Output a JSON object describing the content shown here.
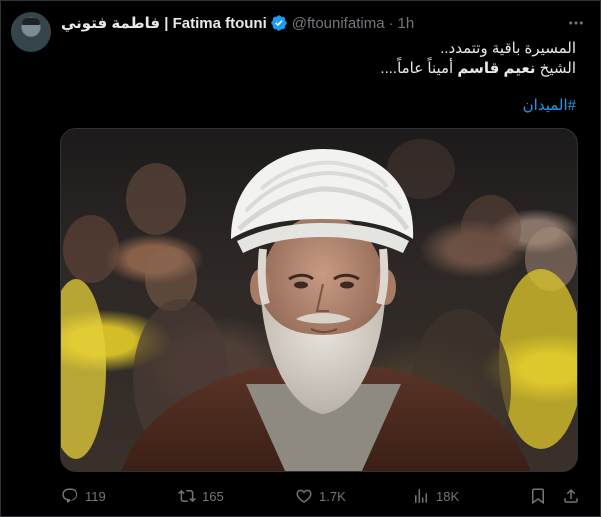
{
  "tweet": {
    "author_name": "فاطمة فتوني | Fatima ftouni",
    "handle": "@ftounifatima",
    "separator": "·",
    "time": "1h",
    "lines": [
      "المسيرة باقية وتتمدد..",
      {
        "parts": [
          "الشيخ ",
          "نعيم قاسم",
          " أميناً عاماً...."
        ]
      }
    ],
    "hashtag": "#الميدان"
  },
  "actions": {
    "replies": "119",
    "reposts": "165",
    "likes": "1.7K",
    "views": "18K"
  },
  "colors": {
    "background": "#000000",
    "text": "#e7e9ea",
    "secondary": "#71767b",
    "link": "#1d9bf0",
    "verified": "#1d9bf0"
  },
  "icons": [
    "verified-badge-icon",
    "more-icon",
    "reply-icon",
    "repost-icon",
    "like-icon",
    "views-icon",
    "bookmark-icon",
    "share-icon"
  ]
}
